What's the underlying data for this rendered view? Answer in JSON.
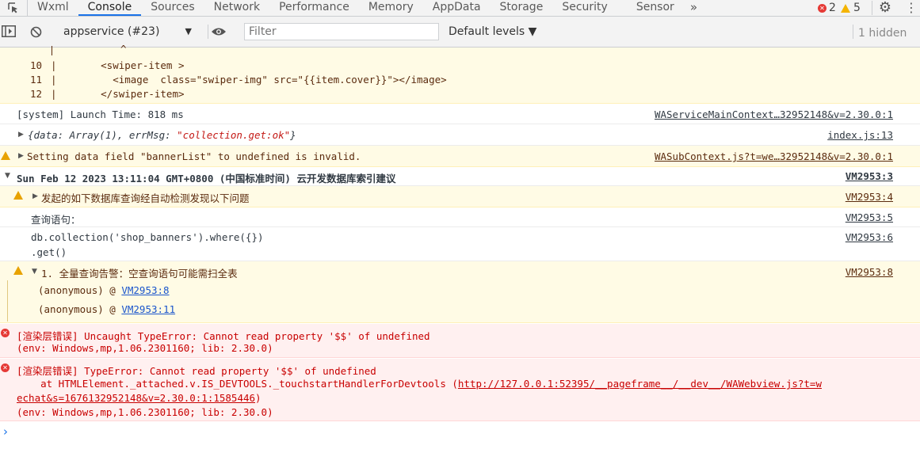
{
  "tabs": [
    "Wxml",
    "Console",
    "Sources",
    "Network",
    "Performance",
    "Memory",
    "AppData",
    "Storage",
    "Security",
    "Sensor"
  ],
  "tab_more": "»",
  "counts": {
    "errors": "2",
    "warnings": "5"
  },
  "toolbar": {
    "context": "appservice (#23)",
    "filter_placeholder": "Filter",
    "levels": "Default levels ▼",
    "hidden": "1 hidden"
  },
  "code_snippet": {
    "caret": "^",
    "lines": [
      {
        "num": "10",
        "code": "      <swiper-item >"
      },
      {
        "num": "11",
        "code": "        <image  class=\"swiper-img\" src=\"{{item.cover}}\"></image>"
      },
      {
        "num": "12",
        "code": "      </swiper-item>"
      }
    ]
  },
  "messages": {
    "launch": {
      "text": "[system] Launch Time: 818 ms",
      "source": "WAServiceMainContext…32952148&v=2.30.0:1"
    },
    "data_obj": {
      "prefix": "{data: Array(1), errMsg: ",
      "errmsg": "\"collection.get:ok\"",
      "suffix": "}",
      "source": "index.js:13"
    },
    "setting_warn": {
      "text": "Setting data field \"bannerList\" to undefined is invalid.",
      "source": "WASubContext.js?t=we…32952148&v=2.30.0:1"
    },
    "group_header": {
      "text": "Sun Feb 12 2023 13:11:04 GMT+0800 (中国标准时间) 云开发数据库索引建议",
      "source": "VM2953:3"
    },
    "auto_detect": {
      "text": "发起的如下数据库查询经自动检测发现以下问题",
      "source": "VM2953:4"
    },
    "query_label": {
      "text": "查询语句：",
      "source": "VM2953:5"
    },
    "query_code": {
      "line1": "db.collection('shop_banners').where({})",
      "line2": ".get()",
      "source": "VM2953:6"
    },
    "full_scan": {
      "text": "1. 全量查询告警：空查询语句可能需扫全表",
      "source": "VM2953:8",
      "stack": [
        {
          "prefix": "(anonymous) @ ",
          "link": "VM2953:8"
        },
        {
          "prefix": "(anonymous) @ ",
          "link": "VM2953:11"
        }
      ]
    },
    "error1": {
      "line1": "[渲染层错误] Uncaught TypeError: Cannot read property '$$' of undefined",
      "line2": "(env: Windows,mp,1.06.2301160; lib: 2.30.0)"
    },
    "error2": {
      "line1": "[渲染层错误] TypeError: Cannot read property '$$' of undefined",
      "line2_prefix": "    at HTMLElement._attached.v.IS_DEVTOOLS._touchstartHandlerForDevtools (",
      "url_part1": "http://127.0.0.1:52395/__pageframe__/__dev__/WAWebview.js?t=w",
      "url_part2": "echat&s=1676132952148&v=2.30.0:1:1585446",
      "url_close": ")",
      "line4": "(env: Windows,mp,1.06.2301160; lib: 2.30.0)"
    }
  },
  "prompt": "›",
  "colors": {
    "accent": "#1a73e8",
    "warning_bg": "#fffbe5",
    "error_bg": "#fff0f0",
    "error_text": "#c80000"
  }
}
